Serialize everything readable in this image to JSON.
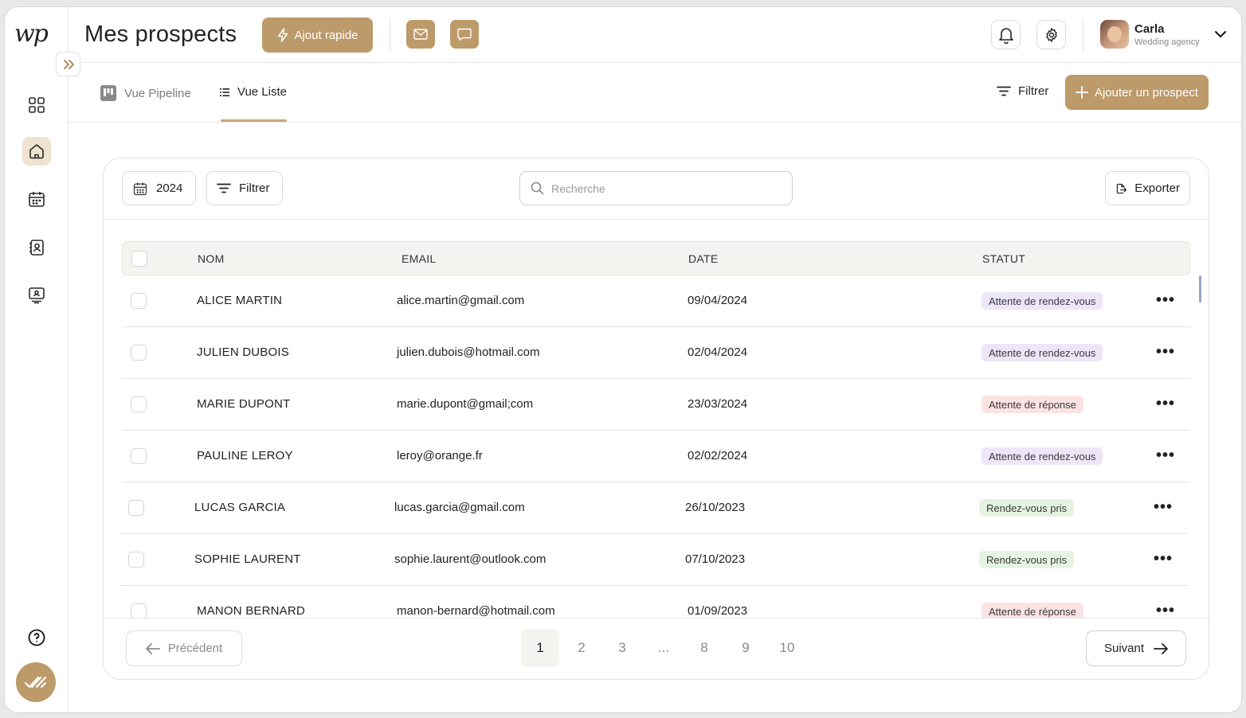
{
  "app": {
    "logo_text": "wp",
    "page_title": "Mes prospects",
    "quick_add_label": "Ajout rapide"
  },
  "user": {
    "name": "Carla",
    "subtitle": "Wedding agency"
  },
  "views": {
    "pipeline_label": "Vue Pipeline",
    "list_label": "Vue Liste",
    "filter_label": "Filtrer",
    "add_prospect_label": "Ajouter un prospect"
  },
  "toolbar": {
    "year": "2024",
    "filter_label": "Filtrer",
    "search_placeholder": "Recherche",
    "export_label": "Exporter"
  },
  "table": {
    "headers": {
      "name": "NOM",
      "email": "EMAIL",
      "date": "DATE",
      "status": "STATUT"
    },
    "rows": [
      {
        "name": "ALICE MARTIN",
        "email": "alice.martin@gmail.com",
        "date": "09/04/2024",
        "status": "Attente de rendez-vous"
      },
      {
        "name": "JULIEN DUBOIS",
        "email": "julien.dubois@hotmail.com",
        "date": "02/04/2024",
        "status": "Attente de rendez-vous"
      },
      {
        "name": "MARIE DUPONT",
        "email": "marie.dupont@gmail;com",
        "date": "23/03/2024",
        "status": "Attente de réponse"
      },
      {
        "name": "PAULINE LEROY",
        "email": "leroy@orange.fr",
        "date": "02/02/2024",
        "status": "Attente de rendez-vous"
      },
      {
        "name": "LUCAS GARCIA",
        "email": "lucas.garcia@gmail.com",
        "date": "26/10/2023",
        "status": "Rendez-vous pris"
      },
      {
        "name": "SOPHIE LAURENT",
        "email": "sophie.laurent@outlook.com",
        "date": "07/10/2023",
        "status": "Rendez-vous pris"
      },
      {
        "name": "MANON BERNARD",
        "email": "manon-bernard@hotmail.com",
        "date": "01/09/2023",
        "status": "Attente de réponse"
      }
    ]
  },
  "pagination": {
    "prev_label": "Précédent",
    "next_label": "Suivant",
    "pages": [
      "1",
      "2",
      "3",
      "...",
      "8",
      "9",
      "10"
    ],
    "current": "1"
  },
  "colors": {
    "accent": "#bd9a69",
    "accent_light": "#efe3d0",
    "status_waiting_meeting": "#ece6f8",
    "status_waiting_reply": "#fbe3e3",
    "status_meeting_booked": "#e5f3e1"
  },
  "icons": {
    "sidebar": [
      "dashboard-icon",
      "home-icon",
      "calendar-icon",
      "contacts-icon",
      "presentation-icon",
      "help-icon"
    ],
    "header": [
      "bolt-icon",
      "mail-icon",
      "chat-icon",
      "bell-icon",
      "gear-icon",
      "chevron-down-icon"
    ]
  }
}
